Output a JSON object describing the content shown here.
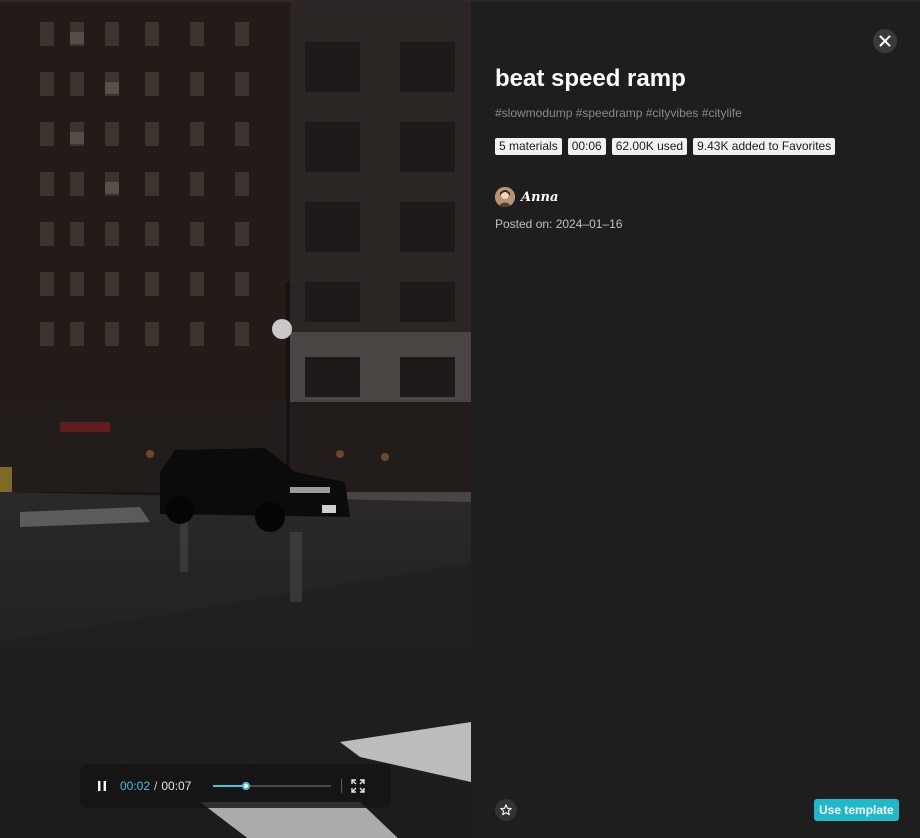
{
  "video": {
    "current_time": "00:02",
    "separator": "/",
    "total_time": "00:07",
    "progress": 0.28
  },
  "template": {
    "title": "beat speed ramp",
    "tags": "#slowmodump #speedramp #cityvibes #citylife",
    "badges": [
      "5 materials",
      "00:06",
      "62.00K used",
      "9.43K added to Favorites"
    ],
    "author": "Anna",
    "posted": "Posted on: 2024–01–16"
  },
  "actions": {
    "use_template": "Use template"
  },
  "icons": {
    "close": "close-icon",
    "pause": "pause-icon",
    "fullscreen": "fullscreen-icon",
    "favorite": "star-icon"
  },
  "colors": {
    "accent": "#1fb9c9",
    "time_accent": "#3ec6d6",
    "background": "#1e1e1e"
  }
}
